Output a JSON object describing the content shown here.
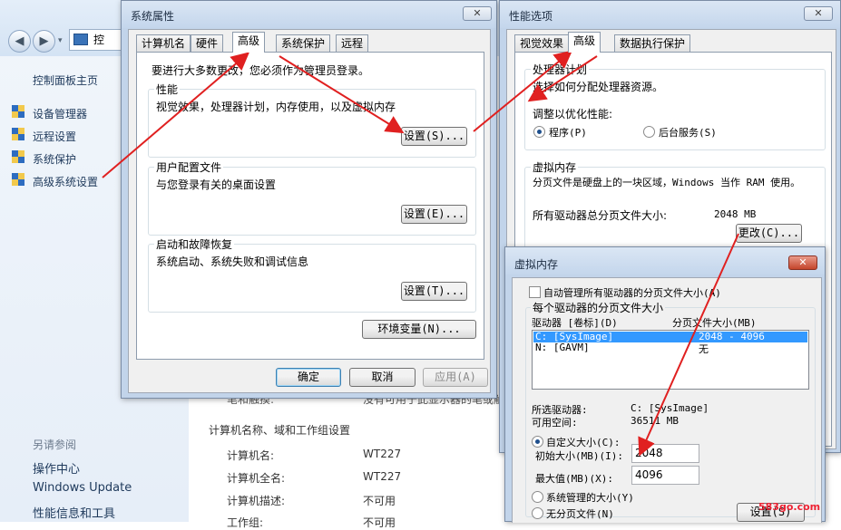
{
  "control_panel": {
    "address_text": "控",
    "side_title": "控制面板主页",
    "side_links": [
      "设备管理器",
      "远程设置",
      "系统保护",
      "高级系统设置"
    ],
    "see_also_title": "另请参阅",
    "see_also": [
      "操作中心",
      "Windows Update",
      "性能信息和工具"
    ],
    "section_title": "计算机名称、域和工作组设置",
    "rows": [
      {
        "label": "计算机名:",
        "value": "WT227"
      },
      {
        "label": "计算机全名:",
        "value": "WT227"
      },
      {
        "label": "计算机描述:",
        "value": "不可用"
      },
      {
        "label": "工作组:",
        "value": "不可用"
      }
    ],
    "pen_row": {
      "label": "笔和触摸:",
      "value": "没有可用于此显示器的笔或触控输入"
    }
  },
  "sys_props": {
    "title": "系统属性",
    "tabs": [
      "计算机名",
      "硬件",
      "高级",
      "系统保护",
      "远程"
    ],
    "admin_note": "要进行大多数更改，您必须作为管理员登录。",
    "perf": {
      "title": "性能",
      "desc": "视觉效果，处理器计划，内存使用，以及虚拟内存",
      "button": "设置(S)..."
    },
    "profile": {
      "title": "用户配置文件",
      "desc": "与您登录有关的桌面设置",
      "button": "设置(E)..."
    },
    "startup": {
      "title": "启动和故障恢复",
      "desc": "系统启动、系统失败和调试信息",
      "button": "设置(T)..."
    },
    "env_button": "环境变量(N)...",
    "ok": "确定",
    "cancel": "取消",
    "apply": "应用(A)"
  },
  "perf_opts": {
    "title": "性能选项",
    "tabs": [
      "视觉效果",
      "高级",
      "数据执行保护"
    ],
    "cpu": {
      "title": "处理器计划",
      "desc": "选择如何分配处理器资源。",
      "adjust": "调整以优化性能:",
      "opt1": "程序(P)",
      "opt2": "后台服务(S)"
    },
    "vm": {
      "title": "虚拟内存",
      "desc": "分页文件是硬盘上的一块区域，Windows 当作 RAM 使用。",
      "total_label": "所有驱动器总分页文件大小:",
      "total_value": "2048 MB",
      "change": "更改(C)..."
    }
  },
  "virt_mem": {
    "title": "虚拟内存",
    "auto": "自动管理所有驱动器的分页文件大小(A)",
    "group": "每个驱动器的分页文件大小",
    "col_drive": "驱动器 [卷标](D)",
    "col_size": "分页文件大小(MB)",
    "drives": [
      {
        "drive": "C:   [SysImage]",
        "size": "2048 - 4096"
      },
      {
        "drive": "N:   [GAVM]",
        "size": "无"
      }
    ],
    "sel_label": "所选驱动器:",
    "sel_value": "C:  [SysImage]",
    "space_label": "可用空间:",
    "space_value": "36511 MB",
    "custom": "自定义大小(C):",
    "init_label": "初始大小(MB)(I):",
    "init_value": "2048",
    "max_label": "最大值(MB)(X):",
    "max_value": "4096",
    "sys_managed": "系统管理的大小(Y)",
    "no_paging": "无分页文件(N)",
    "set_button": "设置(S)"
  },
  "watermark": "583go.com"
}
